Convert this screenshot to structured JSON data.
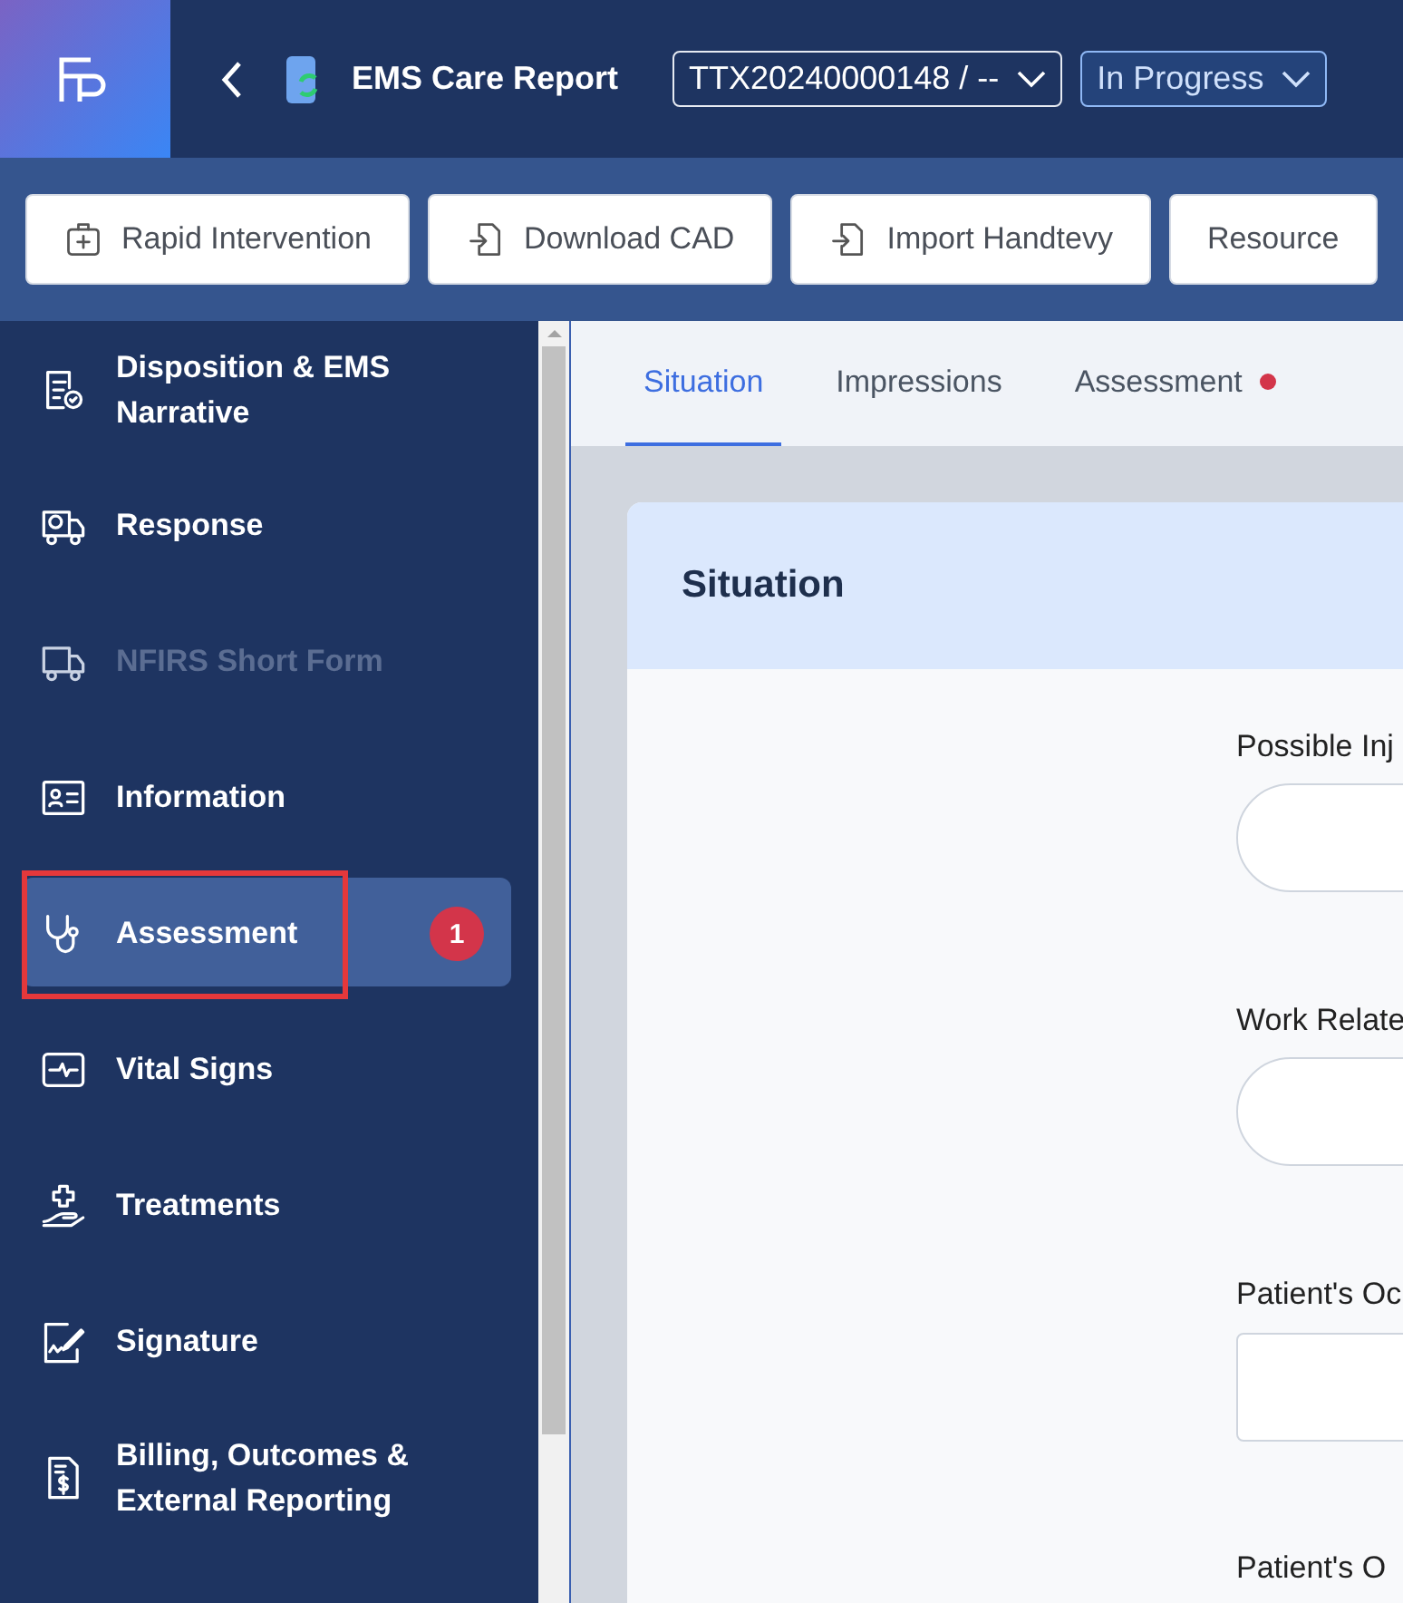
{
  "header": {
    "title": "EMS Care Report",
    "incident": "TTX20240000148 / --",
    "status": "In Progress"
  },
  "toolbar": [
    {
      "label": "Rapid Intervention",
      "kind": "kit"
    },
    {
      "label": "Download CAD",
      "kind": "import"
    },
    {
      "label": "Import Handtevy",
      "kind": "import"
    },
    {
      "label": "Resource",
      "kind": "none"
    }
  ],
  "sidebar": {
    "items": [
      {
        "label": "Disposition & EMS Narrative",
        "kind": "doc-check",
        "selected": false,
        "disabled": false,
        "highlighted": false
      },
      {
        "label": "Response",
        "kind": "truck-clock",
        "selected": false,
        "disabled": false,
        "highlighted": false
      },
      {
        "label": "NFIRS Short Form",
        "kind": "truck",
        "selected": false,
        "disabled": true,
        "highlighted": false
      },
      {
        "label": "Information",
        "kind": "id-card",
        "selected": false,
        "disabled": false,
        "highlighted": false
      },
      {
        "label": "Assessment",
        "kind": "stethoscope",
        "selected": true,
        "disabled": false,
        "highlighted": true,
        "badge": "1"
      },
      {
        "label": "Vital Signs",
        "kind": "monitor",
        "selected": false,
        "disabled": false,
        "highlighted": false
      },
      {
        "label": "Treatments",
        "kind": "hand-cross",
        "selected": false,
        "disabled": false,
        "highlighted": false
      },
      {
        "label": "Signature",
        "kind": "signature",
        "selected": false,
        "disabled": false,
        "highlighted": false
      },
      {
        "label": "Billing, Outcomes & External Reporting",
        "kind": "bill",
        "selected": false,
        "disabled": false,
        "highlighted": false
      }
    ]
  },
  "tabs": [
    {
      "label": "Situation",
      "selected": true,
      "alert": false
    },
    {
      "label": "Impressions",
      "selected": false,
      "alert": false
    },
    {
      "label": "Assessment",
      "selected": false,
      "alert": true
    }
  ],
  "card": {
    "title": "Situation",
    "fields": [
      {
        "label": "Possible Inj",
        "kind": "pill"
      },
      {
        "label": "Work Relate",
        "kind": "pill"
      },
      {
        "label": "Patient's Oc",
        "kind": "box"
      },
      {
        "label": "Patient's O",
        "kind": "label"
      }
    ]
  }
}
